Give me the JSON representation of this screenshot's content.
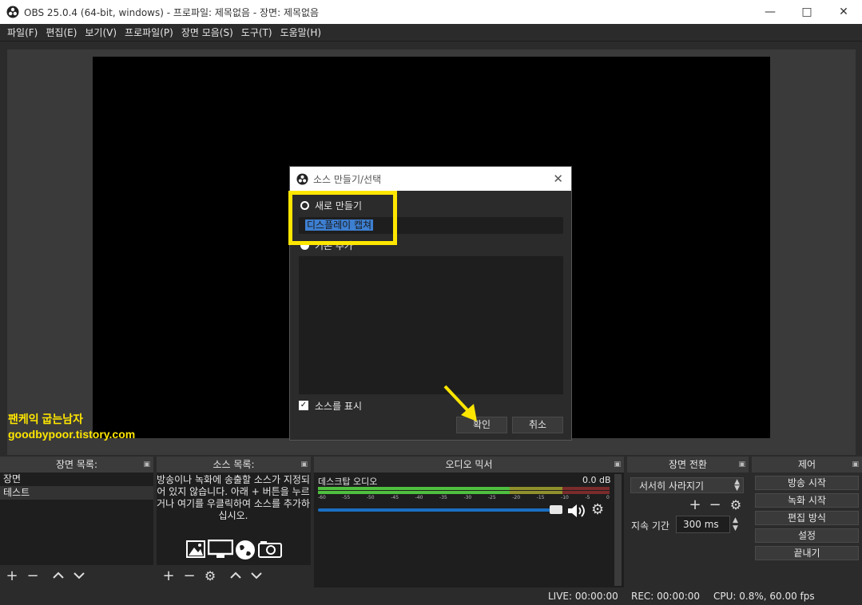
{
  "window": {
    "title": "OBS 25.0.4 (64-bit, windows) - 프로파일: 제목없음 - 장면: 제목없음"
  },
  "menu": [
    "파일(F)",
    "편집(E)",
    "보기(V)",
    "프로파일(P)",
    "장면 모음(S)",
    "도구(T)",
    "도움말(H)"
  ],
  "watermark": {
    "line1": "팬케익 굽는남자",
    "line2": "goodbypoor.tistory.com"
  },
  "docks": {
    "scenes": {
      "title": "장면 목록:",
      "items": [
        "장면",
        "테스트"
      ]
    },
    "sources": {
      "title": "소스 목록:",
      "hint": "방송이나 녹화에 송출할 소스가 지정되어 있지 않습니다. 아래 + 버튼을 누르거나 여기를 우클릭하여 소스를 추가하십시오."
    },
    "mixer": {
      "title": "오디오 믹서",
      "channel": "데스크탑 오디오",
      "level": "0.0 dB",
      "scale": [
        "-60",
        "-55",
        "-50",
        "-45",
        "-40",
        "-35",
        "-30",
        "-25",
        "-20",
        "-15",
        "-10",
        "-5",
        "0"
      ],
      "volume": 0.88
    },
    "transitions": {
      "title": "장면 전환",
      "selected": "서서히 사라지기",
      "duration_label": "지속 기간",
      "duration": "300 ms"
    },
    "controls": {
      "title": "제어",
      "buttons": [
        "방송 시작",
        "녹화 시작",
        "편집 방식",
        "설정",
        "끝내기"
      ]
    }
  },
  "status": {
    "live": "LIVE: 00:00:00",
    "rec": "REC: 00:00:00",
    "cpu": "CPU: 0.8%, 60.00 fps"
  },
  "dialog": {
    "title": "소스 만들기/선택",
    "create_new_label": "새로 만들기",
    "name_value": "디스플레이 캡쳐",
    "add_existing_label": "기존 추가",
    "visible_label": "소스를 표시",
    "ok_label": "확인",
    "cancel_label": "취소"
  },
  "colors": {
    "accent": "#3d7fd1",
    "highlight": "#ffe600"
  }
}
